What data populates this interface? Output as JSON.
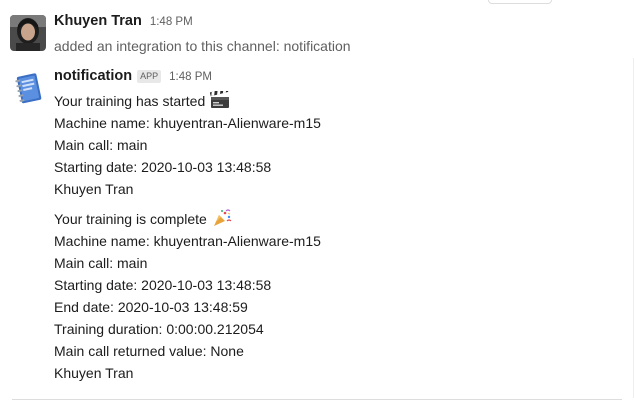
{
  "messages": [
    {
      "sender": "Khuyen Tran",
      "time": "1:48 PM",
      "text": "added an integration to this channel: notification"
    },
    {
      "sender": "notification",
      "badge": "APP",
      "time": "1:48 PM",
      "blocks": [
        {
          "title": "Your training has started",
          "title_icon": "clapper-board-icon",
          "lines": [
            "Machine name: khuyentran-Alienware-m15",
            "Main call: main",
            "Starting date: 2020-10-03 13:48:58",
            "Khuyen Tran"
          ]
        },
        {
          "title": "Your training is complete",
          "title_icon": "party-popper-icon",
          "lines": [
            "Machine name: khuyentran-Alienware-m15",
            "Main call: main",
            "Starting date: 2020-10-03 13:48:58",
            "End date: 2020-10-03 13:48:59",
            "Training duration: 0:00:00.212054",
            "Main call returned value: None",
            "Khuyen Tran"
          ]
        }
      ]
    }
  ],
  "colors": {
    "text": "#1d1c1d",
    "muted": "#616061",
    "divider": "#dddddd"
  }
}
